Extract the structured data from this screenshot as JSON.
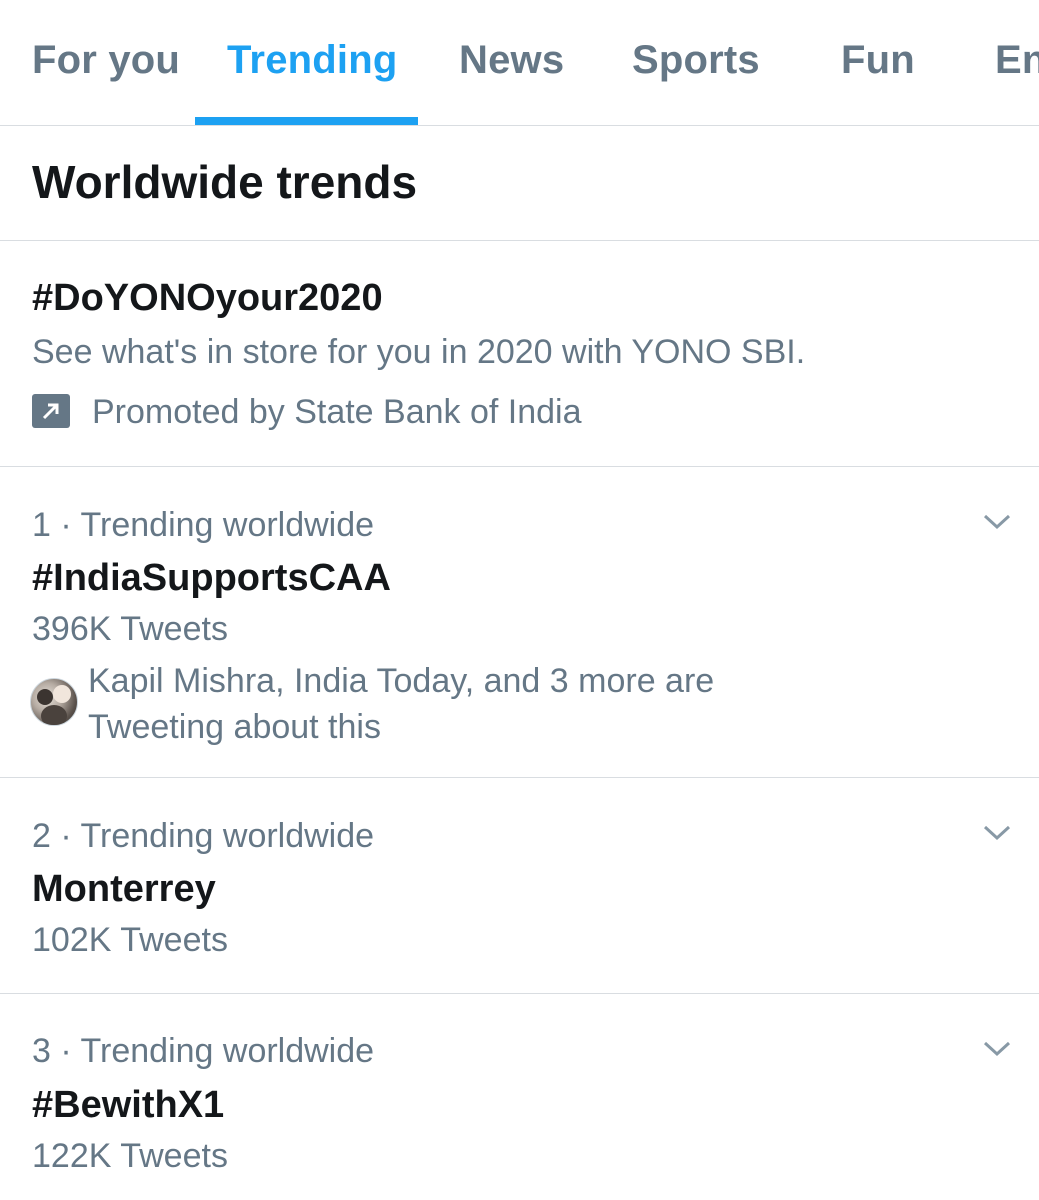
{
  "tabs": [
    "For you",
    "Trending",
    "News",
    "Sports",
    "Fun",
    "En"
  ],
  "active_tab": "Trending",
  "section_title": "Worldwide trends",
  "promoted": {
    "hashtag": "#DoYONOyour2020",
    "description": "See what's in store for you in 2020 with YONO SBI.",
    "promoted_by": "Promoted by State Bank of India",
    "icon": "promoted-arrow-icon"
  },
  "trends": [
    {
      "meta": "1 · Trending worldwide",
      "name": "#IndiaSupportsCAA",
      "count": "396K Tweets",
      "social_line1": "Kapil Mishra, India Today, and 3 more are",
      "social_line2": "Tweeting about this"
    },
    {
      "meta": "2 · Trending worldwide",
      "name": "Monterrey",
      "count": "102K Tweets"
    },
    {
      "meta": "3 · Trending worldwide",
      "name": "#BewithX1",
      "count": "122K Tweets"
    }
  ],
  "colors": {
    "accent": "#1da1f2",
    "secondary_text": "#657786",
    "primary_text": "#14171a",
    "divider": "#d9dde1"
  }
}
